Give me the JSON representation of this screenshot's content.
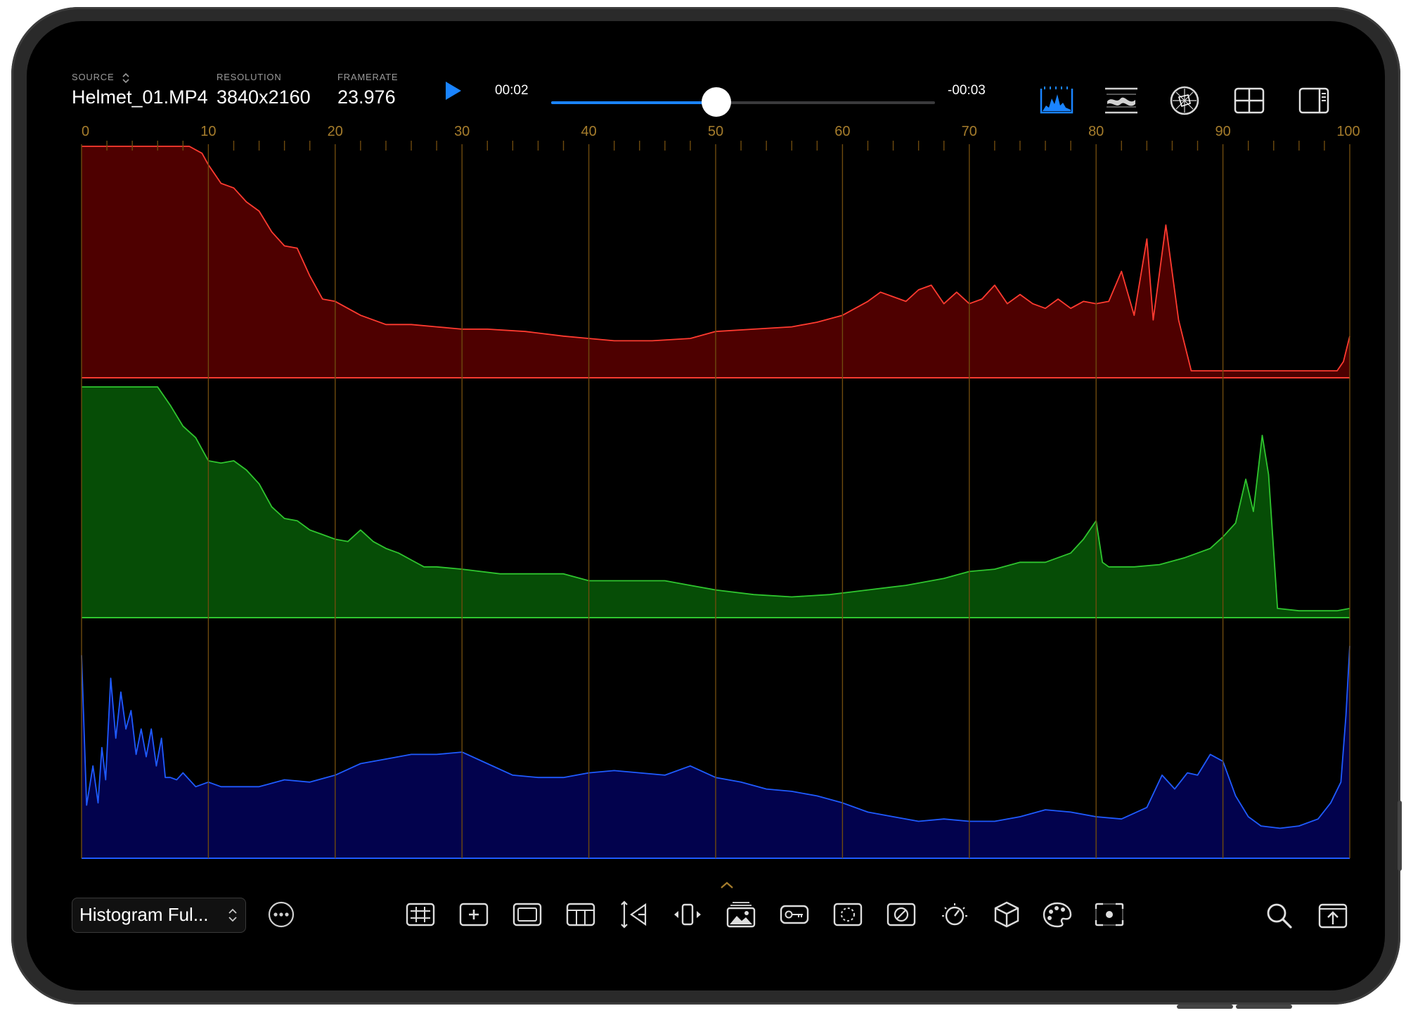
{
  "header": {
    "source_label": "SOURCE",
    "source_value": "Helmet_01.MP4",
    "resolution_label": "RESOLUTION",
    "resolution_value": "3840x2160",
    "framerate_label": "FRAMERATE",
    "framerate_value": "23.976"
  },
  "playback": {
    "elapsed": "00:02",
    "remaining": "-00:03",
    "progress": 0.43
  },
  "top_icons": [
    "histogram-icon",
    "waveform-icon",
    "vectorscope-icon",
    "grid-layout-icon",
    "sidebar-icon"
  ],
  "bottom": {
    "scope_mode": "Histogram Ful...",
    "tools": [
      "grid-overlay-icon",
      "crosshair-icon",
      "safe-area-icon",
      "frame-guide-icon",
      "anamorphic-icon",
      "flip-icon",
      "image-overlay-icon",
      "key-icon",
      "mask-icon",
      "false-color-icon",
      "exposure-icon",
      "3d-lut-icon",
      "palette-icon",
      "focus-peaking-icon"
    ],
    "right_icons": [
      "search-icon",
      "export-icon"
    ]
  },
  "colors": {
    "accent": "#1a84ff",
    "red_line": "#ff3b30",
    "red_fill": "#4e0000",
    "green_line": "#2fc52f",
    "green_fill": "#064d06",
    "blue_line": "#1f5bff",
    "blue_fill": "#02024d",
    "gridline": "#6e4a0e",
    "tick_label": "#a67d2c"
  },
  "chart_data": {
    "type": "area",
    "title": "",
    "xlabel": "",
    "ylabel": "",
    "xlim": [
      0,
      100
    ],
    "ylim": [
      0,
      100
    ],
    "x_ticks": [
      0,
      10,
      20,
      30,
      40,
      50,
      60,
      70,
      80,
      90,
      100
    ],
    "grid": true,
    "series": [
      {
        "channel": "red",
        "points": [
          [
            0,
            100
          ],
          [
            8.5,
            100
          ],
          [
            9.5,
            97
          ],
          [
            10,
            92
          ],
          [
            11,
            84
          ],
          [
            12,
            82
          ],
          [
            13,
            76
          ],
          [
            14,
            72
          ],
          [
            15,
            63
          ],
          [
            16,
            57
          ],
          [
            17,
            56
          ],
          [
            18,
            44
          ],
          [
            19,
            34
          ],
          [
            20,
            33
          ],
          [
            21,
            30
          ],
          [
            22,
            27
          ],
          [
            24,
            23
          ],
          [
            26,
            23
          ],
          [
            28,
            22
          ],
          [
            30,
            21
          ],
          [
            32,
            21
          ],
          [
            35,
            20
          ],
          [
            38,
            18
          ],
          [
            40,
            17
          ],
          [
            42,
            16
          ],
          [
            45,
            16
          ],
          [
            48,
            17
          ],
          [
            50,
            20
          ],
          [
            53,
            21
          ],
          [
            56,
            22
          ],
          [
            58,
            24
          ],
          [
            60,
            27
          ],
          [
            62,
            33
          ],
          [
            63,
            37
          ],
          [
            64,
            35
          ],
          [
            65,
            33
          ],
          [
            66,
            38
          ],
          [
            67,
            40
          ],
          [
            68,
            32
          ],
          [
            69,
            37
          ],
          [
            70,
            32
          ],
          [
            71,
            34
          ],
          [
            72,
            40
          ],
          [
            73,
            32
          ],
          [
            74,
            36
          ],
          [
            75,
            32
          ],
          [
            76,
            30
          ],
          [
            77,
            34
          ],
          [
            78,
            30
          ],
          [
            79,
            33
          ],
          [
            80,
            32
          ],
          [
            81,
            33
          ],
          [
            82,
            46
          ],
          [
            83,
            27
          ],
          [
            84,
            60
          ],
          [
            84.5,
            25
          ],
          [
            85.5,
            66
          ],
          [
            86.5,
            25
          ],
          [
            87.5,
            3
          ],
          [
            90,
            3
          ],
          [
            93,
            3
          ],
          [
            96,
            3
          ],
          [
            99,
            3
          ],
          [
            99.5,
            7
          ],
          [
            100,
            18
          ]
        ]
      },
      {
        "channel": "green",
        "points": [
          [
            0,
            100
          ],
          [
            6,
            100
          ],
          [
            7,
            92
          ],
          [
            8,
            83
          ],
          [
            9,
            78
          ],
          [
            10,
            68
          ],
          [
            11,
            67
          ],
          [
            12,
            68
          ],
          [
            13,
            64
          ],
          [
            14,
            58
          ],
          [
            15,
            48
          ],
          [
            16,
            43
          ],
          [
            17,
            42
          ],
          [
            18,
            38
          ],
          [
            19,
            36
          ],
          [
            20,
            34
          ],
          [
            21,
            33
          ],
          [
            22,
            38
          ],
          [
            23,
            33
          ],
          [
            24,
            30
          ],
          [
            25,
            28
          ],
          [
            26,
            25
          ],
          [
            27,
            22
          ],
          [
            28,
            22
          ],
          [
            30,
            21
          ],
          [
            33,
            19
          ],
          [
            36,
            19
          ],
          [
            38,
            19
          ],
          [
            40,
            16
          ],
          [
            43,
            16
          ],
          [
            46,
            16
          ],
          [
            48,
            14
          ],
          [
            50,
            12
          ],
          [
            53,
            10
          ],
          [
            56,
            9
          ],
          [
            59,
            10
          ],
          [
            62,
            12
          ],
          [
            65,
            14
          ],
          [
            68,
            17
          ],
          [
            70,
            20
          ],
          [
            72,
            21
          ],
          [
            74,
            24
          ],
          [
            76,
            24
          ],
          [
            78,
            28
          ],
          [
            79,
            34
          ],
          [
            80,
            42
          ],
          [
            80.5,
            24
          ],
          [
            81,
            22
          ],
          [
            83,
            22
          ],
          [
            85,
            23
          ],
          [
            87,
            26
          ],
          [
            88,
            28
          ],
          [
            89,
            30
          ],
          [
            90,
            35
          ],
          [
            91,
            41
          ],
          [
            91.8,
            60
          ],
          [
            92.4,
            46
          ],
          [
            93.1,
            79
          ],
          [
            93.6,
            62
          ],
          [
            94.3,
            4
          ],
          [
            96,
            3
          ],
          [
            99,
            3
          ],
          [
            100,
            4
          ]
        ]
      },
      {
        "channel": "blue",
        "points": [
          [
            0,
            88
          ],
          [
            0.4,
            23
          ],
          [
            0.9,
            40
          ],
          [
            1.3,
            24
          ],
          [
            1.6,
            48
          ],
          [
            1.9,
            34
          ],
          [
            2.3,
            78
          ],
          [
            2.7,
            52
          ],
          [
            3.1,
            72
          ],
          [
            3.5,
            56
          ],
          [
            3.9,
            64
          ],
          [
            4.3,
            45
          ],
          [
            4.7,
            56
          ],
          [
            5.1,
            44
          ],
          [
            5.5,
            56
          ],
          [
            5.9,
            40
          ],
          [
            6.3,
            52
          ],
          [
            6.6,
            35
          ],
          [
            7,
            35
          ],
          [
            7.5,
            34
          ],
          [
            8,
            37
          ],
          [
            9,
            31
          ],
          [
            10,
            33
          ],
          [
            11,
            31
          ],
          [
            12,
            31
          ],
          [
            14,
            31
          ],
          [
            16,
            34
          ],
          [
            18,
            33
          ],
          [
            20,
            36
          ],
          [
            22,
            41
          ],
          [
            24,
            43
          ],
          [
            26,
            45
          ],
          [
            28,
            45
          ],
          [
            30,
            46
          ],
          [
            32,
            41
          ],
          [
            34,
            36
          ],
          [
            36,
            35
          ],
          [
            38,
            35
          ],
          [
            40,
            37
          ],
          [
            42,
            38
          ],
          [
            44,
            37
          ],
          [
            46,
            36
          ],
          [
            48,
            40
          ],
          [
            50,
            35
          ],
          [
            52,
            33
          ],
          [
            54,
            30
          ],
          [
            56,
            29
          ],
          [
            58,
            27
          ],
          [
            60,
            24
          ],
          [
            62,
            20
          ],
          [
            64,
            18
          ],
          [
            66,
            16
          ],
          [
            68,
            17
          ],
          [
            70,
            16
          ],
          [
            72,
            16
          ],
          [
            74,
            18
          ],
          [
            76,
            21
          ],
          [
            78,
            20
          ],
          [
            80,
            18
          ],
          [
            82,
            17
          ],
          [
            84,
            22
          ],
          [
            85.2,
            36
          ],
          [
            86.2,
            30
          ],
          [
            87.2,
            37
          ],
          [
            88,
            36
          ],
          [
            89,
            45
          ],
          [
            90,
            42
          ],
          [
            91,
            27
          ],
          [
            92,
            18
          ],
          [
            93,
            14
          ],
          [
            94.5,
            13
          ],
          [
            96,
            14
          ],
          [
            97.5,
            17
          ],
          [
            98.5,
            24
          ],
          [
            99.3,
            33
          ],
          [
            99.7,
            62
          ],
          [
            100,
            92
          ]
        ]
      }
    ]
  }
}
